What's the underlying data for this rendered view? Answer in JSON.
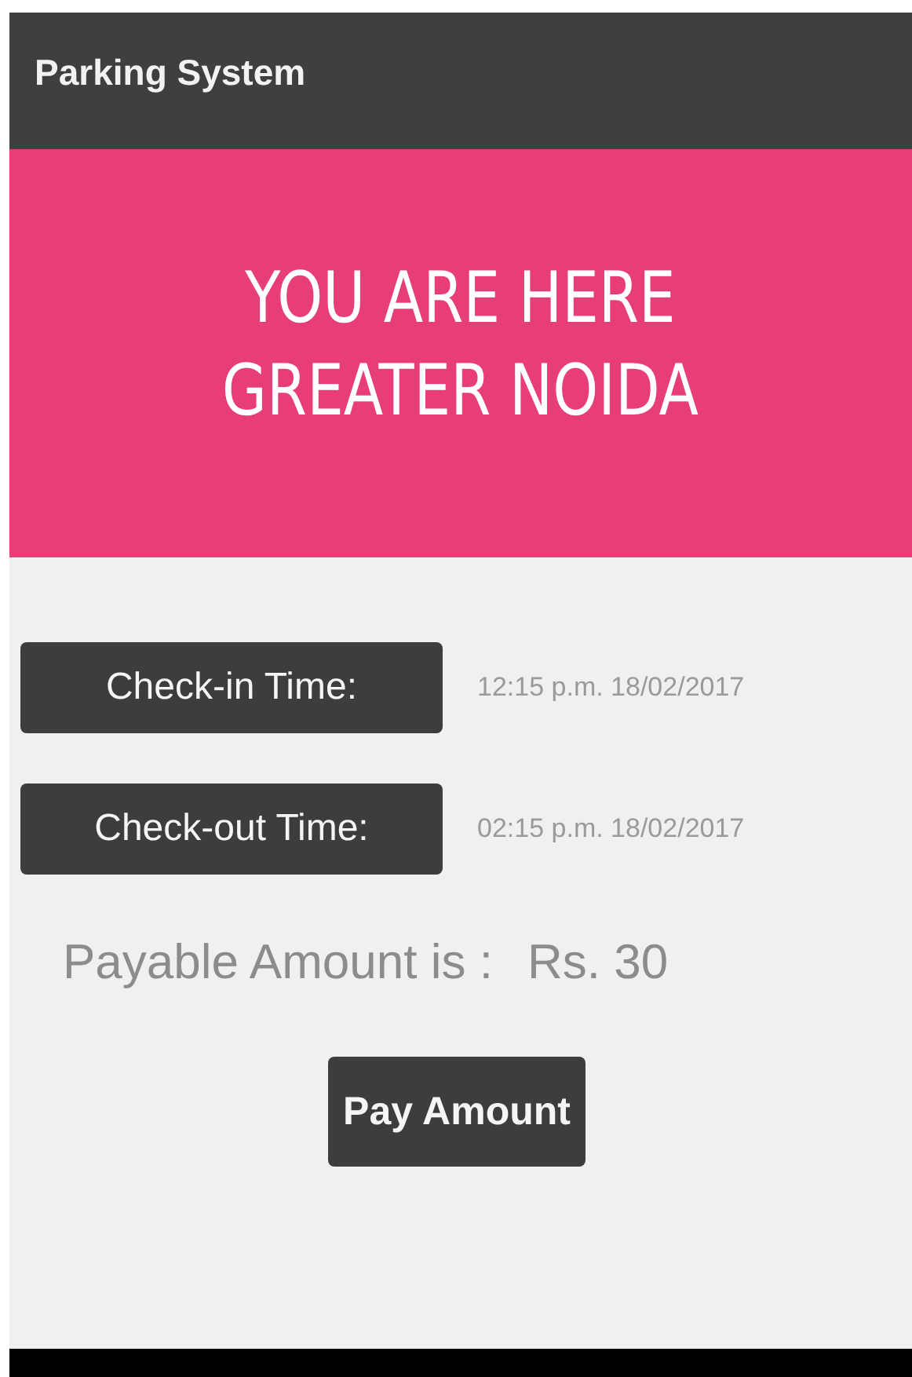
{
  "app_bar": {
    "title": "Parking System"
  },
  "banner": {
    "lines": [
      "YOU ARE HERE",
      "GREATER NOIDA"
    ]
  },
  "times": [
    {
      "label": "Check-in Time:",
      "value": "12:15 p.m. 18/02/2017"
    },
    {
      "label": "Check-out Time:",
      "value": "02:15 p.m. 18/02/2017"
    }
  ],
  "payable": {
    "label": "Payable Amount is :",
    "amount": "Rs. 30"
  },
  "pay_button": {
    "label": "Pay Amount"
  }
}
